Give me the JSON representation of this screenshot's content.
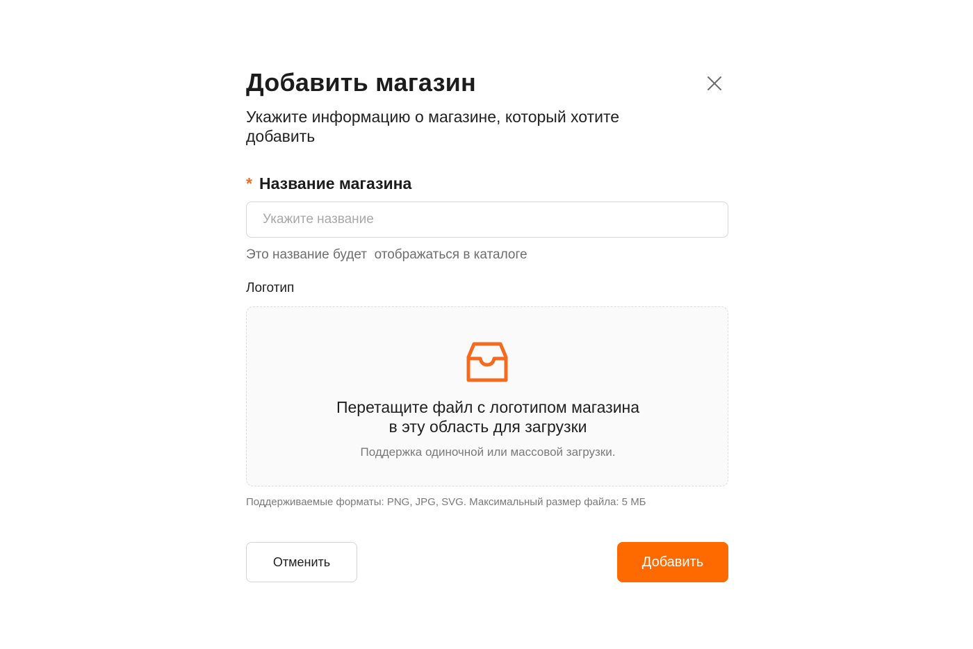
{
  "modal": {
    "title": "Добавить магазин",
    "subtitle": "Укажите информацию о магазине, который хотите добавить",
    "close_icon": "close-icon"
  },
  "store_name_field": {
    "required_mark": "*",
    "label": "Название магазина",
    "value": "",
    "placeholder": "Укажите название",
    "hint": "Это название будет  отображаться в каталоге"
  },
  "logo_field": {
    "label": "Логотип",
    "dropzone": {
      "icon": "inbox-icon",
      "line1": "Перетащите файл с логотипом магазина",
      "line2": "в эту область для загрузки",
      "sub": "Поддержка одиночной или массовой загрузки."
    },
    "formats": "Поддерживаемые форматы: PNG, JPG, SVG. Максимальный размер файла: 5 МБ"
  },
  "actions": {
    "cancel_label": "Отменить",
    "submit_label": "Добавить"
  },
  "colors": {
    "accent": "#ff6a00",
    "required": "#f46a1f"
  }
}
